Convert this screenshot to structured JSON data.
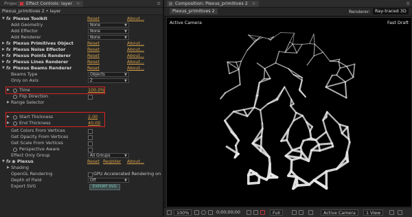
{
  "tabs_left": {
    "project": "Project",
    "effect_controls": "Effect Controls: layer",
    "menu": "≡"
  },
  "tabs_right": {
    "composition": "Composition: Plexus_primitives 2",
    "menu": "≡"
  },
  "ec_subtitle": "Plexus_primitives 2 • layer",
  "rows": {
    "toolkit": {
      "label": "Plexus Toolkit",
      "reset": "Reset",
      "about": "About..."
    },
    "add_geometry": {
      "label": "Add Geometry",
      "value": "None"
    },
    "add_effector": {
      "label": "Add Effector",
      "value": "None"
    },
    "add_renderer": {
      "label": "Add Renderer",
      "value": "None"
    },
    "primitives_object": {
      "label": "Plexus Primitives Object",
      "reset": "Reset",
      "about": "About..."
    },
    "noise_effector": {
      "label": "Plexus Noise Effector",
      "reset": "Reset",
      "about": "About..."
    },
    "points_renderer": {
      "label": "Plexus Points Renderer",
      "reset": "Reset",
      "about": "About..."
    },
    "lines_renderer": {
      "label": "Plexus Lines Renderer",
      "reset": "Reset",
      "about": "About..."
    },
    "beams_renderer": {
      "label": "Plexus Beams Renderer",
      "reset": "Reset",
      "about": "About..."
    },
    "beams_type": {
      "label": "Beams Type",
      "value": "Objects"
    },
    "only_on_axis": {
      "label": "Only on Axis",
      "value": "Z"
    },
    "time": {
      "label": "Time",
      "value": "100.0%"
    },
    "flip_direction": {
      "label": "Flip Direction"
    },
    "range_selector": {
      "label": "Range Selector"
    },
    "start_thickness": {
      "label": "Start Thickness",
      "value": "2.00"
    },
    "end_thickness": {
      "label": "End Thickness",
      "value": "40.00"
    },
    "colors_from_vertices": {
      "label": "Get Colors From Vertices"
    },
    "opacity_from_vertices": {
      "label": "Get Opacity From Vertices"
    },
    "scale_from_vertices": {
      "label": "Get Scale From Vertices"
    },
    "perspective_aware": {
      "label": "Perspective Aware"
    },
    "effect_only_group": {
      "label": "Effect Only Group",
      "value": "All Groups"
    },
    "plexus": {
      "label": "Plexus",
      "reset": "Reset",
      "register": "Register",
      "about": "About..."
    },
    "shading": {
      "label": "Shading"
    },
    "opengl_rendering": {
      "label": "OpenGL Rendering",
      "value": "GPU Accelerated Rendering on"
    },
    "depth_of_field": {
      "label": "Depth of Field",
      "value": "Off"
    },
    "export_svg": {
      "label": "Export SVG",
      "button": "EXPORT SVG"
    }
  },
  "comp": {
    "sub_tab": "Plexus_primitives 2",
    "renderer_label": "Renderer:",
    "renderer_value": "Ray-traced 3D",
    "camera_label": "Active Camera",
    "draft_label": "Fast Draft"
  },
  "bottom": {
    "zoom": "100%",
    "timecode": "0;00;00;00",
    "resolution": "Full",
    "camera": "Active Camera",
    "view": "1 View"
  },
  "colors": {
    "accent_orange": "#e0a13e",
    "highlight_red": "#dd2222",
    "comp_tab": "#c8343a"
  }
}
